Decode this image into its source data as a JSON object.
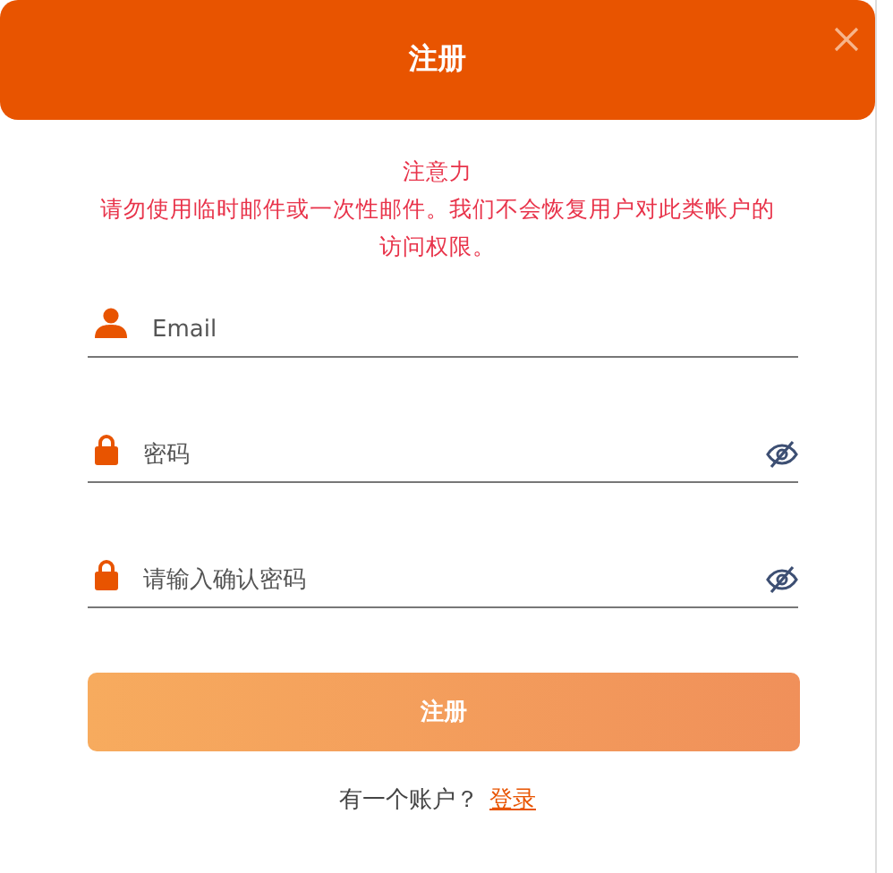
{
  "dialog": {
    "title": "注册",
    "notice_title": "注意力",
    "notice_text": "请勿使用临时邮件或一次性邮件。我们不会恢复用户对此类帐户的访问权限。"
  },
  "fields": [
    {
      "kind": "email",
      "placeholder": "Email"
    },
    {
      "kind": "password",
      "placeholder": "密码"
    },
    {
      "kind": "password",
      "placeholder": "请输入确认密码"
    }
  ],
  "submit": "注册",
  "footer": {
    "text": "有一个账户？",
    "link": "登录"
  }
}
